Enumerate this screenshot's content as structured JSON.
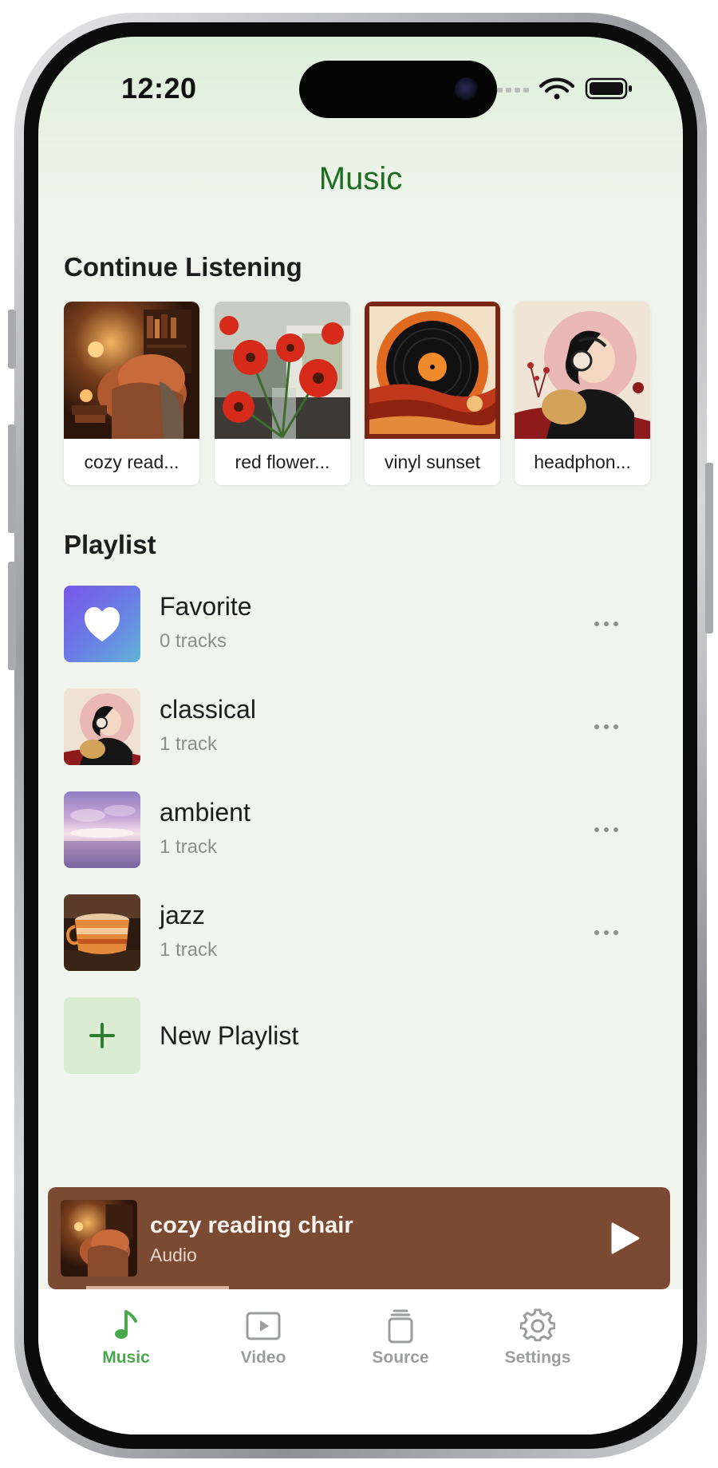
{
  "status_bar": {
    "time": "12:20"
  },
  "header": {
    "title": "Music"
  },
  "continue_listening": {
    "heading": "Continue Listening",
    "items": [
      {
        "label": "cozy read...",
        "art": "cozy-reading-chair-art"
      },
      {
        "label": "red flower...",
        "art": "red-flowers-art"
      },
      {
        "label": "vinyl sunset",
        "art": "vinyl-sunset-art"
      },
      {
        "label": "headphon...",
        "art": "headphones-art"
      }
    ]
  },
  "playlist": {
    "heading": "Playlist",
    "items": [
      {
        "name": "Favorite",
        "count": "0 tracks",
        "art": "heart-icon"
      },
      {
        "name": "classical",
        "count": "1 track",
        "art": "headphones-art"
      },
      {
        "name": "ambient",
        "count": "1 track",
        "art": "sky-art"
      },
      {
        "name": "jazz",
        "count": "1 track",
        "art": "coffee-cup-art"
      }
    ],
    "new_label": "New Playlist"
  },
  "now_playing": {
    "title": "cozy reading chair",
    "subtitle": "Audio",
    "progress": 0.26,
    "background": "#7b4a33"
  },
  "tabs": [
    {
      "label": "Music",
      "icon": "music-note-icon",
      "active": true
    },
    {
      "label": "Video",
      "icon": "video-play-icon",
      "active": false
    },
    {
      "label": "Source",
      "icon": "source-cylinder-icon",
      "active": false
    },
    {
      "label": "Settings",
      "icon": "gear-icon",
      "active": false
    }
  ],
  "colors": {
    "accent": "#4aa84c",
    "title": "#1f6b22",
    "player": "#7b4a33"
  }
}
